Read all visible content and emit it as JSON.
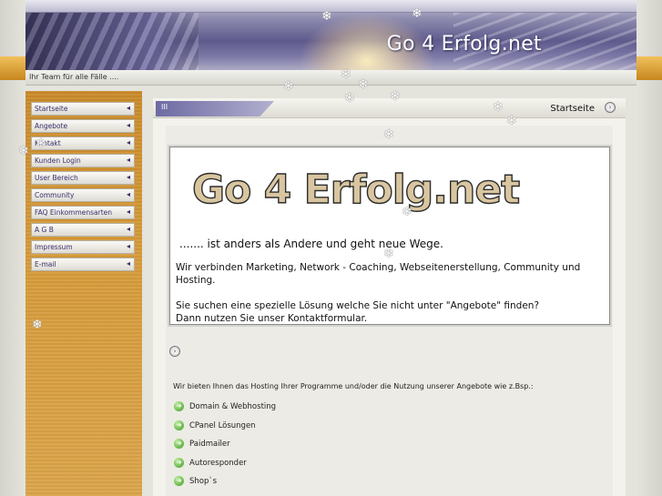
{
  "banner": {
    "site_title": "Go 4 Erfolg.net"
  },
  "tagline": "Ihr Team für alle Fälle ....",
  "nav": {
    "arrow_glyph": "◂",
    "items": [
      {
        "label": "Startseite"
      },
      {
        "label": "Angebote"
      },
      {
        "label": "Kontakt"
      },
      {
        "label": "Kunden Login"
      },
      {
        "label": "User Bereich"
      },
      {
        "label": "Community"
      },
      {
        "label": "FAQ Einkommensarten"
      },
      {
        "label": "A G B"
      },
      {
        "label": "Impressum"
      },
      {
        "label": "E-mail"
      }
    ]
  },
  "content": {
    "tab_label": "III",
    "page_title": "Startseite",
    "logo_text": "Go 4 Erfolg.net",
    "slogan": "....... ist anders als Andere und geht neue Wege.",
    "desc_1": "Wir verbinden Marketing, Network - Coaching, Webseitenerstellung, Community und Hosting.",
    "desc_2": "Sie suchen eine spezielle Lösung welche Sie nicht unter \"Angebote\" finden?\nDann nutzen Sie unser Kontaktformular.",
    "offer_intro": "Wir bieten Ihnen das Hosting Ihrer Programme und/oder die Nutzung unserer Angebote wie z.Bsp.:",
    "offers": [
      {
        "label": "Domain & Webhosting"
      },
      {
        "label": "CPanel Lösungen"
      },
      {
        "label": "Paidmailer"
      },
      {
        "label": "Autoresponder"
      },
      {
        "label": "Shop`s"
      }
    ]
  },
  "colors": {
    "sidebar_gold": "#d69a39",
    "banner_purple": "#5e5a8c",
    "nav_text": "#3a2e6e",
    "bullet_green": "#3f9a1f"
  },
  "icons": {
    "nav_arrow": "arrow-left-icon",
    "panel_button": "circle-button-icon",
    "offer_bullet": "green-arrow-icon",
    "decor": "snowflake-icon"
  }
}
